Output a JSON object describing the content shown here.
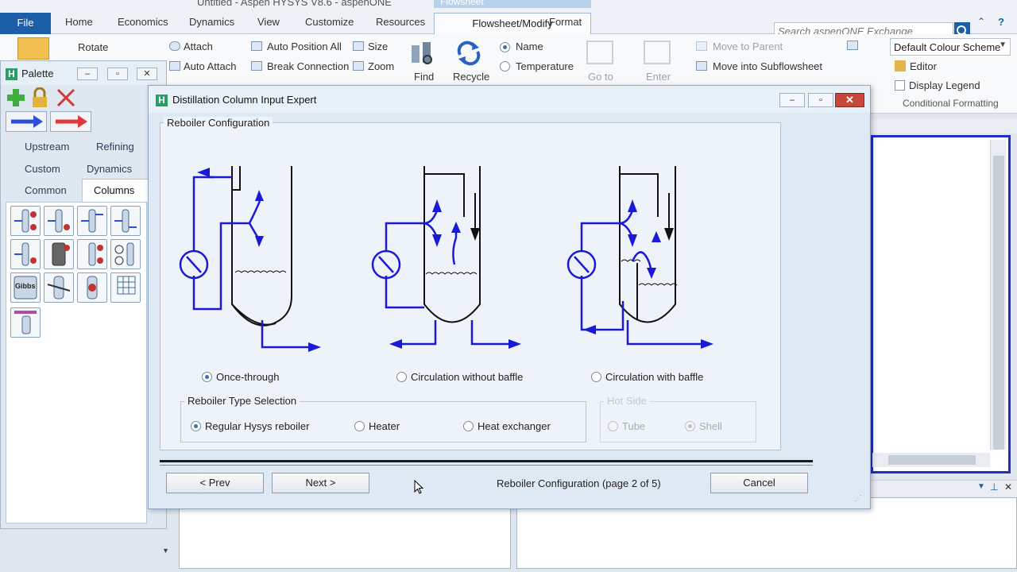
{
  "titlebar": {
    "text": "Untitled - Aspen HYSYS V8.6 - aspenONE",
    "context": "Flowsheet"
  },
  "tabs": {
    "file": "File",
    "home": "Home",
    "economics": "Economics",
    "dynamics": "Dynamics",
    "view": "View",
    "customize": "Customize",
    "resources": "Resources",
    "flowsheet_modify": "Flowsheet/Modify",
    "format": "Format"
  },
  "search": {
    "placeholder": "Search aspenONE Exchange"
  },
  "ribbon": {
    "rotate": "Rotate",
    "attach": "Attach",
    "auto_attach": "Auto Attach",
    "auto_position_all": "Auto Position All",
    "break_connection": "Break Connection",
    "size": "Size",
    "zoom": "Zoom",
    "find": "Find",
    "recycle": "Recycle",
    "name": "Name",
    "temperature": "Temperature",
    "go_to": "Go to",
    "enter": "Enter",
    "move_to_parent": "Move to Parent",
    "move_into_subflowsheet": "Move into Subflowsheet",
    "colour_scheme": "Default Colour Scheme",
    "editor": "Editor",
    "display_legend": "Display Legend",
    "conditional_formatting": "Conditional Formatting"
  },
  "palette": {
    "title": "Palette",
    "tabs": [
      "Upstream",
      "Refining",
      "Custom",
      "Dynamics",
      "Common",
      "Columns"
    ],
    "gibbs_label": "Gibbs"
  },
  "dialog": {
    "title": "Distillation Column Input Expert",
    "section": "Reboiler Configuration",
    "config_options": [
      "Once-through",
      "Circulation without baffle",
      "Circulation with baffle"
    ],
    "selected_config": "Once-through",
    "type_group": "Reboiler Type Selection",
    "type_options": [
      "Regular Hysys reboiler",
      "Heater",
      "Heat exchanger"
    ],
    "selected_type": "Regular Hysys reboiler",
    "hot_side_group": "Hot Side",
    "hot_side_options": [
      "Tube",
      "Shell"
    ],
    "prev": "< Prev",
    "next": "Next >",
    "status": "Reboiler Configuration (page 2 of 5)",
    "cancel": "Cancel"
  },
  "colors": {
    "accent": "#1c5fa8",
    "stream": "#1a1ad6",
    "close": "#c7483b",
    "canvas_border": "#1f2fbf"
  }
}
